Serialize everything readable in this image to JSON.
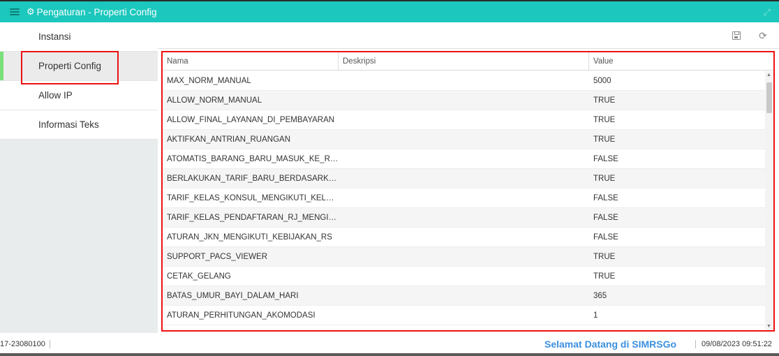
{
  "window": {
    "title": "Pengaturan - Properti Config"
  },
  "sidebar": {
    "items": [
      {
        "label": "Instansi",
        "active": false
      },
      {
        "label": "Properti Config",
        "active": true
      },
      {
        "label": "Allow IP",
        "active": false
      },
      {
        "label": "Informasi Teks",
        "active": false
      }
    ]
  },
  "table": {
    "columns": [
      "Nama",
      "Deskripsi",
      "Value"
    ],
    "rows": [
      {
        "nama": "MAX_NORM_MANUAL",
        "deskripsi": "",
        "value": "5000"
      },
      {
        "nama": "ALLOW_NORM_MANUAL",
        "deskripsi": "",
        "value": "TRUE"
      },
      {
        "nama": "ALLOW_FINAL_LAYANAN_DI_PEMBAYARAN",
        "deskripsi": "",
        "value": "TRUE"
      },
      {
        "nama": "AKTIFKAN_ANTRIAN_RUANGAN",
        "deskripsi": "",
        "value": "TRUE"
      },
      {
        "nama": "ATOMATIS_BARANG_BARU_MASUK_KE_RUA...",
        "deskripsi": "",
        "value": "FALSE"
      },
      {
        "nama": "BERLAKUKAN_TARIF_BARU_BERDASARKAN_...",
        "deskripsi": "",
        "value": "TRUE"
      },
      {
        "nama": "TARIF_KELAS_KONSUL_MENGIKUTI_KELAS_R...",
        "deskripsi": "",
        "value": "FALSE"
      },
      {
        "nama": "TARIF_KELAS_PENDAFTARAN_RJ_MENGIKUTI...",
        "deskripsi": "",
        "value": "FALSE"
      },
      {
        "nama": "ATURAN_JKN_MENGIKUTI_KEBIJAKAN_RS",
        "deskripsi": "",
        "value": "FALSE"
      },
      {
        "nama": "SUPPORT_PACS_VIEWER",
        "deskripsi": "",
        "value": "TRUE"
      },
      {
        "nama": "CETAK_GELANG",
        "deskripsi": "",
        "value": "TRUE"
      },
      {
        "nama": "BATAS_UMUR_BAYI_DALAM_HARI",
        "deskripsi": "",
        "value": "365"
      },
      {
        "nama": "ATURAN_PERHITUNGAN_AKOMODASI",
        "deskripsi": "",
        "value": "1"
      }
    ]
  },
  "statusbar": {
    "version": "17-23080100",
    "welcome": "Selamat Datang di SIMRSGo",
    "datetime": "09/08/2023 09:51:22"
  },
  "colors": {
    "header": "#1cc7bd",
    "highlight": "#ee1111",
    "active_marker": "#7be07b",
    "welcome": "#3b8fe0"
  },
  "icons": {
    "menu": "hamburger-icon",
    "gear": "gear-icon",
    "expand": "expand-icon",
    "save": "save-icon",
    "refresh": "refresh-icon"
  }
}
